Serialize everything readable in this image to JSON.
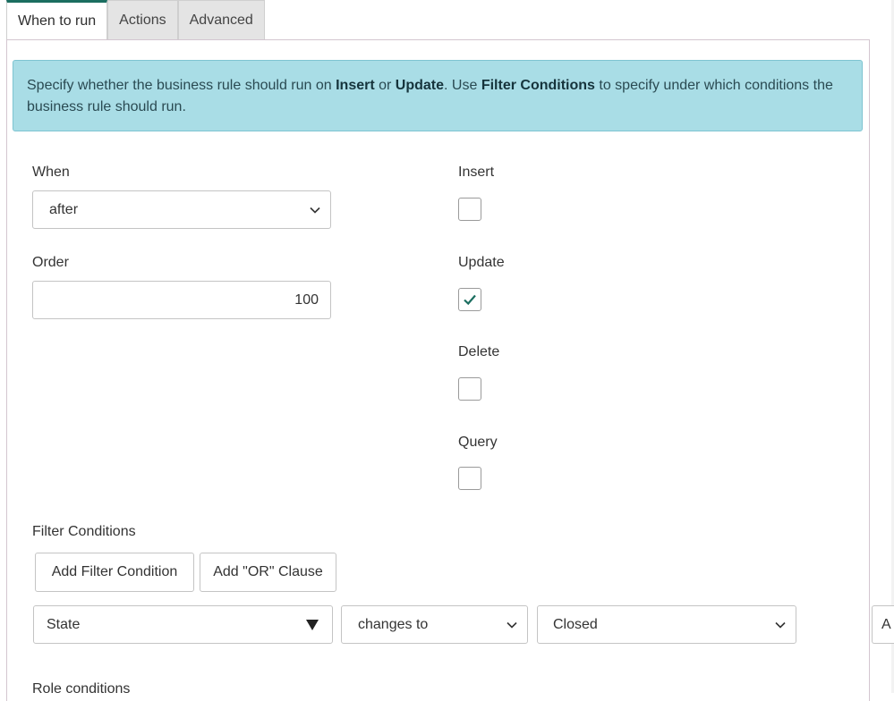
{
  "tabs": [
    {
      "label": "When to run",
      "active": true
    },
    {
      "label": "Actions",
      "active": false
    },
    {
      "label": "Advanced",
      "active": false
    }
  ],
  "banner": {
    "part1": "Specify whether the business rule should run on ",
    "insert": "Insert",
    "part2": " or ",
    "update": "Update",
    "part3": ". Use ",
    "filter_conditions": "Filter Conditions",
    "part4": " to specify under which conditions the business rule should run."
  },
  "when": {
    "label": "When",
    "value": "after"
  },
  "order": {
    "label": "Order",
    "value": "100"
  },
  "insert": {
    "label": "Insert",
    "checked": false
  },
  "update": {
    "label": "Update",
    "checked": true
  },
  "delete": {
    "label": "Delete",
    "checked": false
  },
  "query": {
    "label": "Query",
    "checked": false
  },
  "filter": {
    "label": "Filter Conditions",
    "add_condition": "Add Filter Condition",
    "add_or": "Add \"OR\" Clause",
    "field": "State",
    "operator": "changes to",
    "value": "Closed",
    "clipped_button": "A"
  },
  "role": {
    "label": "Role conditions"
  },
  "colors": {
    "accent": "#1b6e60",
    "banner_bg": "#a9dde6"
  }
}
